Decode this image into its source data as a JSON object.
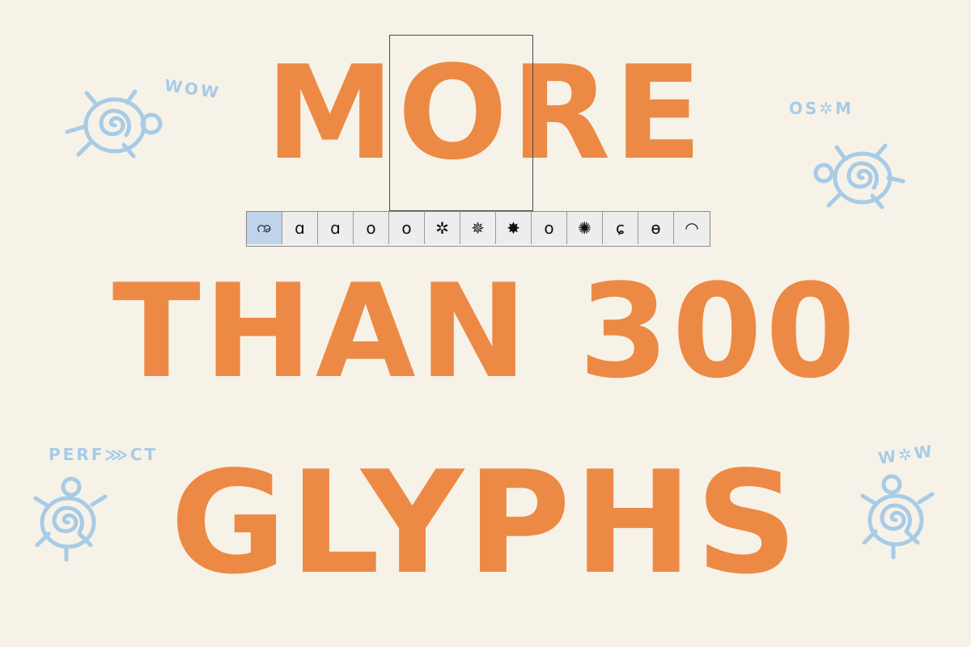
{
  "headline": {
    "line1": "MORE",
    "line2": "THAN 300",
    "line3": "GLYPHS"
  },
  "glyph_strip": {
    "glyphs": [
      "ꩠ",
      "ɑ",
      "ɑ",
      "o",
      "o",
      "✲",
      "✵",
      "✸",
      "o",
      "✺",
      "ɕ",
      "ɵ",
      "◠"
    ],
    "selected_index": 0
  },
  "decorations": {
    "words": [
      "WOW",
      "OS✲M",
      "PERF⋙CT",
      "W✲W"
    ],
    "icons": [
      "turtle-icon",
      "turtle-icon",
      "turtle-icon",
      "turtle-icon"
    ]
  },
  "colors": {
    "background": "#f7f2e8",
    "headline": "#ec8a45",
    "decoration": "#a8cbe6",
    "selected_cell": "#bfd3ea"
  }
}
